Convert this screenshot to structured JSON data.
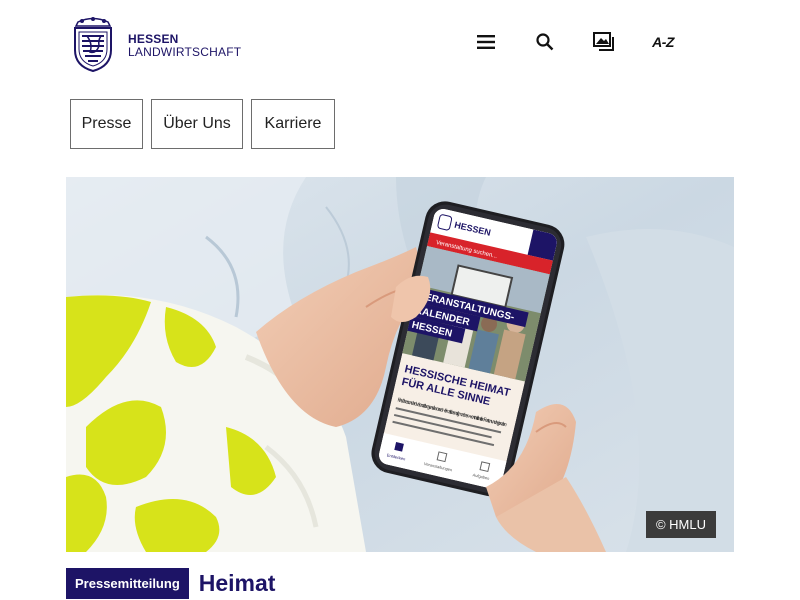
{
  "brand": {
    "line1": "HESSEN",
    "line2": "LANDWIRTSCHAFT",
    "color": "#1d1466"
  },
  "header": {
    "icons": [
      {
        "name": "menu-icon"
      },
      {
        "name": "search-icon"
      },
      {
        "name": "gallery-icon"
      },
      {
        "name": "a-z-icon",
        "label": "A-Z"
      }
    ]
  },
  "nav": {
    "items": [
      "Presse",
      "Über Uns",
      "Karriere"
    ]
  },
  "hero": {
    "credit": "© HMLU",
    "phone": {
      "app_brand": "HESSEN",
      "search_placeholder": "Veranstaltung suchen...",
      "banner_lines": [
        "VERANSTALTUNGS-",
        "KALENDER",
        "HESSEN"
      ],
      "headline_lines": [
        "HESSISCHE HEIMAT",
        "FÜR ALLE SINNE"
      ],
      "body_text": "Finde besondere Veranstaltungen, die unsere Heimat lebendig machen – von traditionellen Festen und regionalen",
      "bottom_nav": [
        "Entdecken",
        "Veranstaltungen",
        "Aufgaben"
      ]
    },
    "colors": {
      "accent_red": "#d8232a",
      "dark_purple": "#1d1466",
      "shirt_yellow": "#d7e31a"
    }
  },
  "article": {
    "badge": "Pressemitteilung",
    "title": "Heimat"
  }
}
